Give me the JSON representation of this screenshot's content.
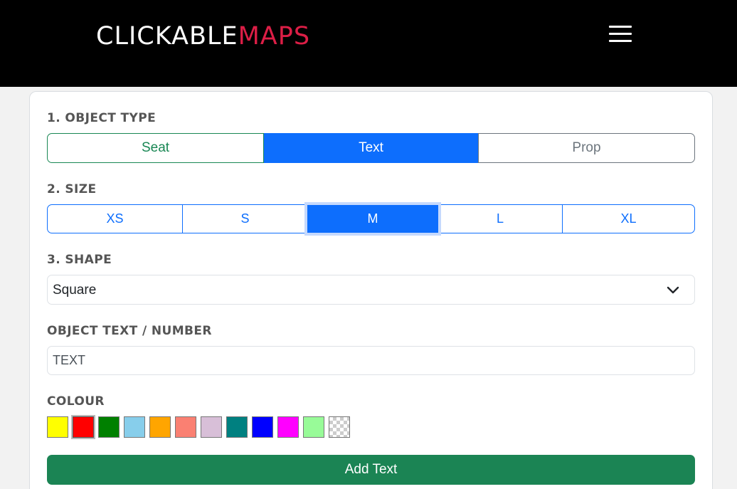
{
  "header": {
    "logo_part1": "CLICKABLE",
    "logo_part2": "MAPS",
    "logo_colors": {
      "main": "#ffffff",
      "accent": "#dc1e46"
    },
    "menu_icon": "hamburger-icon"
  },
  "form": {
    "object_type": {
      "label": "1. OBJECT TYPE",
      "options": [
        "Seat",
        "Text",
        "Prop"
      ],
      "selected": "Text"
    },
    "size": {
      "label": "2. SIZE",
      "options": [
        "XS",
        "S",
        "M",
        "L",
        "XL"
      ],
      "selected": "M"
    },
    "shape": {
      "label": "3. SHAPE",
      "selected": "Square",
      "icon": "chevron-down-icon"
    },
    "object_text": {
      "label": "OBJECT TEXT / NUMBER",
      "value": "TEXT"
    },
    "colour": {
      "label": "COLOUR",
      "swatches": [
        "#ffff00",
        "#ff0000",
        "#008000",
        "#87ceeb",
        "#ffa500",
        "#fa8072",
        "#d8bfd8",
        "#008080",
        "#0000ff",
        "#ff00ff",
        "#98fb98",
        "transparent"
      ],
      "selected": "#ff0000"
    },
    "submit_label": "Add Text"
  },
  "colors": {
    "primary": "#0d6efd",
    "success": "#198754",
    "button_green": "#1b8454",
    "secondary": "#6c757d"
  }
}
